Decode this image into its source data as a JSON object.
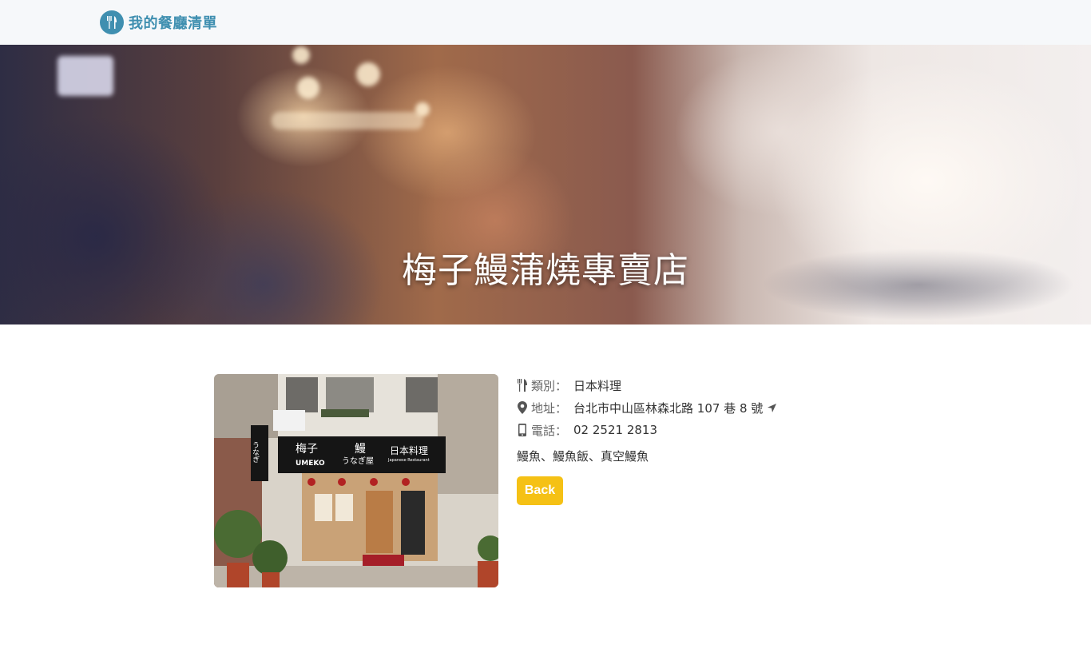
{
  "navbar": {
    "brand": "我的餐廳清單",
    "brand_icon": "utensils-icon",
    "brand_color": "#3f8fb0"
  },
  "hero": {
    "title": "梅子鰻蒲燒專賣店"
  },
  "restaurant": {
    "category_label": "類別：",
    "category": "日本料理",
    "address_label": "地址：",
    "address": "台北市中山區林森北路 107 巷 8 號",
    "phone_label": "電話：",
    "phone": "02 2521 2813",
    "description": "鰻魚、鰻魚飯、真空鰻魚",
    "photo_sign_name": "梅子",
    "photo_sign_en": "UMEKO",
    "photo_sign_eel": "鰻",
    "photo_sign_kana": "うなぎ屋",
    "photo_sign_cuisine": "日本料理",
    "photo_sign_cuisine_en": "Japanese Restaurant",
    "photo_side_sign": "うなぎ"
  },
  "actions": {
    "back_label": "Back",
    "back_color": "#f5c115"
  }
}
